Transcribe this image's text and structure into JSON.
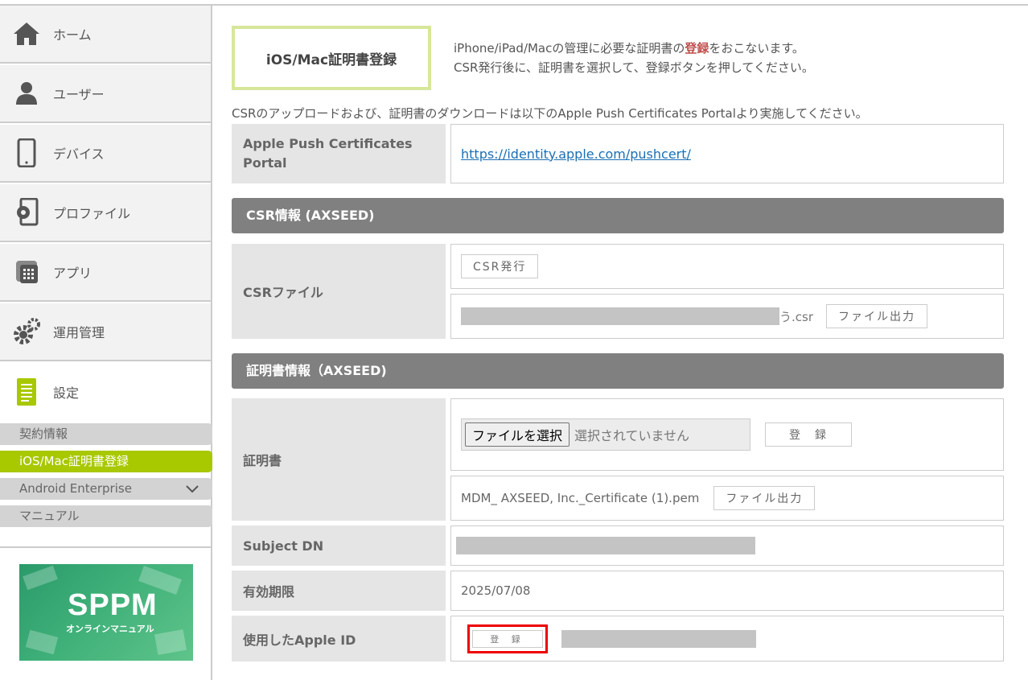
{
  "nav": {
    "items": [
      {
        "label": "ホーム",
        "icon": "home-icon"
      },
      {
        "label": "ユーザー",
        "icon": "user-icon"
      },
      {
        "label": "デバイス",
        "icon": "device-icon"
      },
      {
        "label": "プロファイル",
        "icon": "profile-icon"
      },
      {
        "label": "アプリ",
        "icon": "app-icon"
      },
      {
        "label": "運用管理",
        "icon": "gear-icon"
      },
      {
        "label": "設定",
        "icon": "settings-doc-icon"
      }
    ],
    "sub_items": [
      {
        "label": "契約情報"
      },
      {
        "label": "iOS/Mac証明書登録",
        "active": true
      },
      {
        "label": "Android Enterprise"
      },
      {
        "label": "マニュアル"
      }
    ],
    "banner": {
      "title": "SPPM",
      "subtitle": "オンラインマニュアル"
    }
  },
  "page": {
    "title": "iOS/Mac証明書登録",
    "desc_line1_pre": "iPhone/iPad/Macの管理に必要な証明書の",
    "desc_line1_hl": "登録",
    "desc_line1_post": "をおこないます。",
    "desc_line2": "CSR発行後に、証明書を選択して、登録ボタンを押してください。",
    "note": "CSRのアップロードおよび、証明書のダウンロードは以下のApple Push Certificates Portalより実施してください。"
  },
  "portal": {
    "label_line1": "Apple Push Certificates",
    "label_line2": "Portal",
    "url": "https://identity.apple.com/pushcert/"
  },
  "csr_section": {
    "header": "CSR情報 (AXSEED)",
    "file_label": "CSRファイル",
    "issue_button": "CSR発行",
    "file_suffix": "う.csr",
    "export_button": "ファイル出力"
  },
  "cert_section": {
    "header": "証明書情報（AXSEED)",
    "cert_label": "証明書",
    "choose_file_button": "ファイルを選択",
    "no_file_text": "選択されていません",
    "register_button": "登　録",
    "cert_filename": "MDM_ AXSEED, Inc._Certificate (1).pem",
    "export_button": "ファイル出力",
    "subject_dn_label": "Subject DN",
    "expiry_label": "有効期限",
    "expiry_value": "2025/07/08",
    "apple_id_label": "使用したApple ID",
    "apple_id_register_button": "登 録"
  },
  "colors": {
    "accent": "#a8c800",
    "section_header": "#808080",
    "highlight": "#c0504d",
    "link": "#1a6fb5",
    "callout": "#ee0000"
  }
}
